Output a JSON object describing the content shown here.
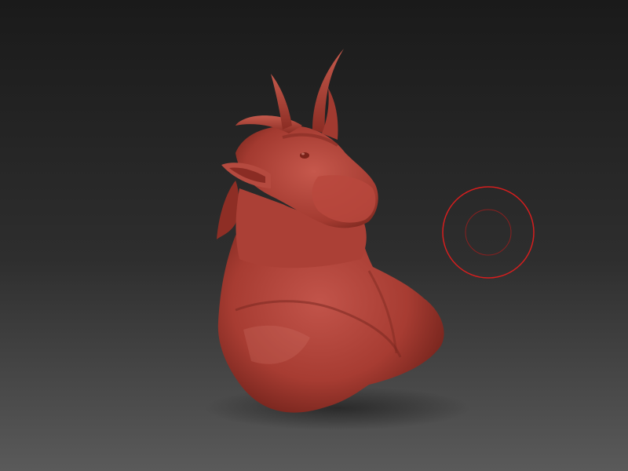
{
  "viewport": {
    "background_top": "#1a1a1a",
    "background_bottom": "#5a5a5a",
    "model_subject": "sculpted-goat-bust",
    "model_color": "#b5453a",
    "model_shadow": "#6a1f18",
    "model_highlight": "#d4786a"
  },
  "brush_cursor": {
    "outer_ring_color": "#d61e1e",
    "inner_ring_color": "#8a2020"
  }
}
